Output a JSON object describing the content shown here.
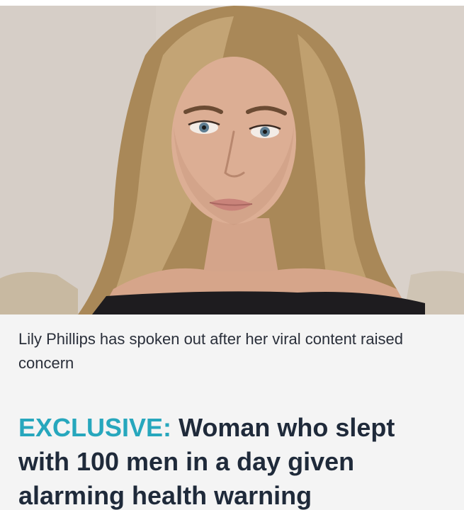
{
  "article": {
    "image_caption": "Lily Phillips has spoken out after her viral content raised concern",
    "headline_tag": "EXCLUSIVE:",
    "headline_text": "Woman who slept with 100 men in a day given alarming health warning"
  },
  "colors": {
    "tag_accent": "#27a7bd",
    "headline": "#1f2a3a",
    "caption": "#2a2f3a",
    "background": "#f4f4f4"
  }
}
